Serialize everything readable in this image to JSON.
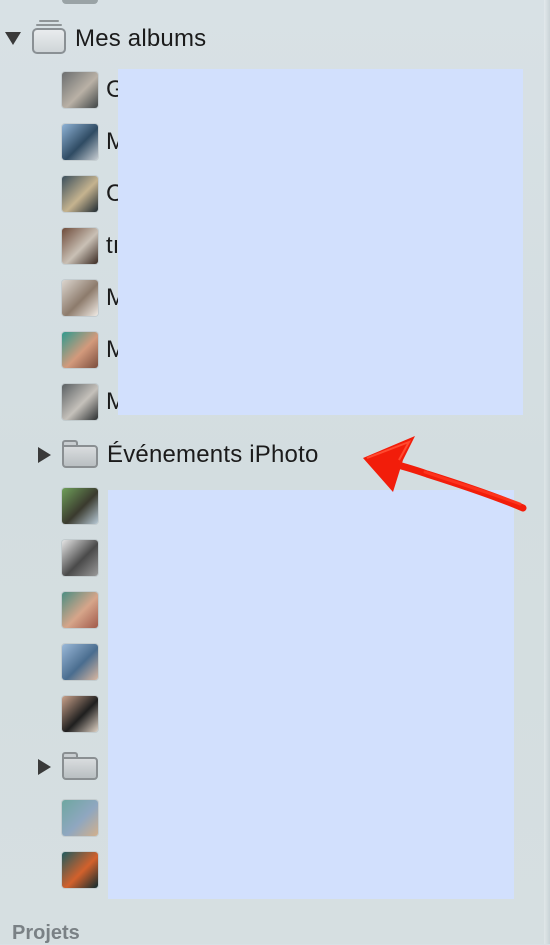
{
  "sidebar": {
    "albums_group": {
      "label": "Mes albums",
      "expanded": true,
      "icon": "album-stack-icon"
    },
    "album_items": [
      {
        "initial": "G",
        "thumb_colors": [
          "#6b6e6f",
          "#b9b1a6",
          "#3f4546"
        ]
      },
      {
        "initial": "M",
        "thumb_colors": [
          "#8fb3d6",
          "#2f4b63",
          "#c7cdd2"
        ]
      },
      {
        "initial": "C",
        "thumb_colors": [
          "#3b4f5c",
          "#c5b38f",
          "#1f2b33"
        ]
      },
      {
        "initial": "tı",
        "thumb_colors": [
          "#6e4b3a",
          "#c9c0b5",
          "#3a2a22"
        ]
      },
      {
        "initial": "M",
        "thumb_colors": [
          "#dcd6cf",
          "#8d7b6c",
          "#f1ece6"
        ]
      },
      {
        "initial": "M",
        "thumb_colors": [
          "#2f9a8e",
          "#d39a7c",
          "#7a4d3d"
        ]
      },
      {
        "initial": "M",
        "thumb_colors": [
          "#5a6063",
          "#c5c1bb",
          "#2b2f31"
        ]
      }
    ],
    "events_folder": {
      "label": "Événements iPhoto",
      "expanded": false,
      "icon": "folder-icon"
    },
    "item_thumbs_lower": [
      {
        "thumb_colors": [
          "#6fa05a",
          "#3a3a2e",
          "#b7c9d6"
        ]
      },
      {
        "thumb_colors": [
          "#e6e6e6",
          "#4a4a4a",
          "#9a9a9a"
        ]
      },
      {
        "thumb_colors": [
          "#4b8d82",
          "#d6a58a",
          "#a05a4a"
        ]
      },
      {
        "thumb_colors": [
          "#9bb9d9",
          "#4a6d8f",
          "#d9b7a0"
        ]
      },
      {
        "thumb_colors": [
          "#caa28b",
          "#1f1f1f",
          "#e0d2c4"
        ]
      }
    ],
    "lower_folder": {
      "expanded": false,
      "icon": "folder-icon"
    },
    "item_thumbs_bottom": [
      {
        "thumb_colors": [
          "#6ea7a0",
          "#8fa7c0",
          "#d2b08c"
        ]
      },
      {
        "thumb_colors": [
          "#1f5a5e",
          "#d2612c",
          "#0f2b2e"
        ]
      }
    ],
    "projects_section": "Projets"
  },
  "annotation": {
    "arrow_color": "#f21d0a",
    "points_to": "Événements iPhoto"
  },
  "redaction_color": "#d2e0fd"
}
